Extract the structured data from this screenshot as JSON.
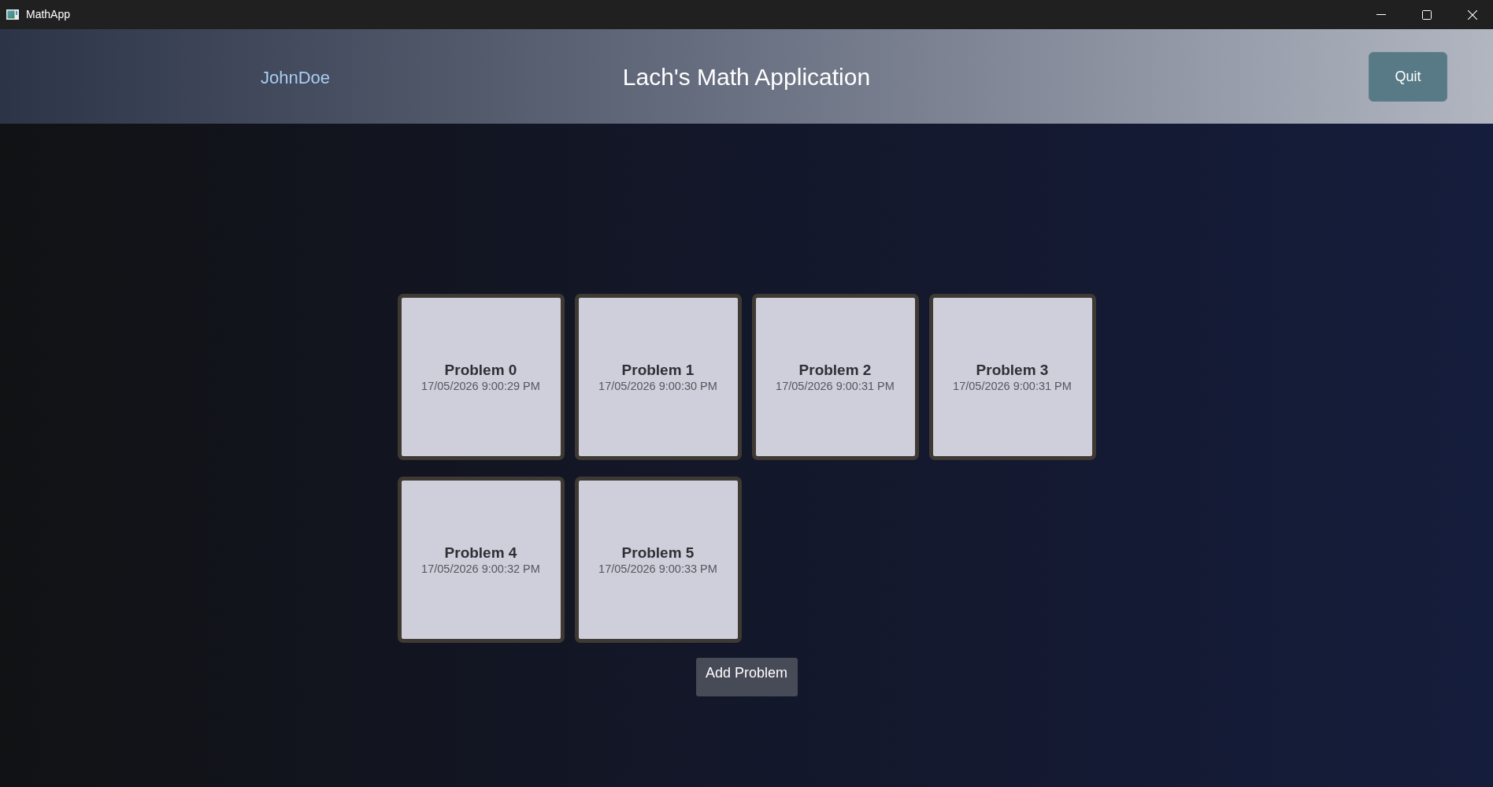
{
  "window": {
    "title": "MathApp"
  },
  "header": {
    "username": "JohnDoe",
    "title": "Lach's Math Application",
    "quit_button": "Quit"
  },
  "problems": [
    {
      "title": "Problem 0",
      "timestamp": "17/05/2026 9:00:29 PM"
    },
    {
      "title": "Problem 1",
      "timestamp": "17/05/2026 9:00:30 PM"
    },
    {
      "title": "Problem 2",
      "timestamp": "17/05/2026 9:00:31 PM"
    },
    {
      "title": "Problem 3",
      "timestamp": "17/05/2026 9:00:31 PM"
    },
    {
      "title": "Problem 4",
      "timestamp": "17/05/2026 9:00:32 PM"
    },
    {
      "title": "Problem 5",
      "timestamp": "17/05/2026 9:00:33 PM"
    }
  ],
  "add_button": "Add Problem"
}
